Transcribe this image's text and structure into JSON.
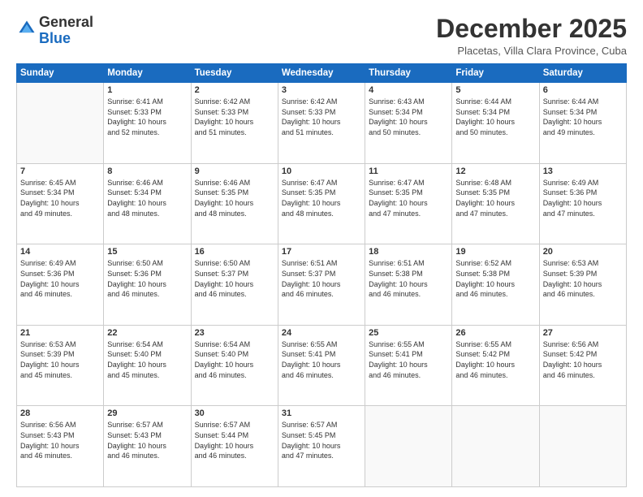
{
  "logo": {
    "general": "General",
    "blue": "Blue"
  },
  "header": {
    "month": "December 2025",
    "location": "Placetas, Villa Clara Province, Cuba"
  },
  "days": [
    "Sunday",
    "Monday",
    "Tuesday",
    "Wednesday",
    "Thursday",
    "Friday",
    "Saturday"
  ],
  "weeks": [
    [
      {
        "day": "",
        "content": ""
      },
      {
        "day": "1",
        "content": "Sunrise: 6:41 AM\nSunset: 5:33 PM\nDaylight: 10 hours\nand 52 minutes."
      },
      {
        "day": "2",
        "content": "Sunrise: 6:42 AM\nSunset: 5:33 PM\nDaylight: 10 hours\nand 51 minutes."
      },
      {
        "day": "3",
        "content": "Sunrise: 6:42 AM\nSunset: 5:33 PM\nDaylight: 10 hours\nand 51 minutes."
      },
      {
        "day": "4",
        "content": "Sunrise: 6:43 AM\nSunset: 5:34 PM\nDaylight: 10 hours\nand 50 minutes."
      },
      {
        "day": "5",
        "content": "Sunrise: 6:44 AM\nSunset: 5:34 PM\nDaylight: 10 hours\nand 50 minutes."
      },
      {
        "day": "6",
        "content": "Sunrise: 6:44 AM\nSunset: 5:34 PM\nDaylight: 10 hours\nand 49 minutes."
      }
    ],
    [
      {
        "day": "7",
        "content": "Sunrise: 6:45 AM\nSunset: 5:34 PM\nDaylight: 10 hours\nand 49 minutes."
      },
      {
        "day": "8",
        "content": "Sunrise: 6:46 AM\nSunset: 5:34 PM\nDaylight: 10 hours\nand 48 minutes."
      },
      {
        "day": "9",
        "content": "Sunrise: 6:46 AM\nSunset: 5:35 PM\nDaylight: 10 hours\nand 48 minutes."
      },
      {
        "day": "10",
        "content": "Sunrise: 6:47 AM\nSunset: 5:35 PM\nDaylight: 10 hours\nand 48 minutes."
      },
      {
        "day": "11",
        "content": "Sunrise: 6:47 AM\nSunset: 5:35 PM\nDaylight: 10 hours\nand 47 minutes."
      },
      {
        "day": "12",
        "content": "Sunrise: 6:48 AM\nSunset: 5:35 PM\nDaylight: 10 hours\nand 47 minutes."
      },
      {
        "day": "13",
        "content": "Sunrise: 6:49 AM\nSunset: 5:36 PM\nDaylight: 10 hours\nand 47 minutes."
      }
    ],
    [
      {
        "day": "14",
        "content": "Sunrise: 6:49 AM\nSunset: 5:36 PM\nDaylight: 10 hours\nand 46 minutes."
      },
      {
        "day": "15",
        "content": "Sunrise: 6:50 AM\nSunset: 5:36 PM\nDaylight: 10 hours\nand 46 minutes."
      },
      {
        "day": "16",
        "content": "Sunrise: 6:50 AM\nSunset: 5:37 PM\nDaylight: 10 hours\nand 46 minutes."
      },
      {
        "day": "17",
        "content": "Sunrise: 6:51 AM\nSunset: 5:37 PM\nDaylight: 10 hours\nand 46 minutes."
      },
      {
        "day": "18",
        "content": "Sunrise: 6:51 AM\nSunset: 5:38 PM\nDaylight: 10 hours\nand 46 minutes."
      },
      {
        "day": "19",
        "content": "Sunrise: 6:52 AM\nSunset: 5:38 PM\nDaylight: 10 hours\nand 46 minutes."
      },
      {
        "day": "20",
        "content": "Sunrise: 6:53 AM\nSunset: 5:39 PM\nDaylight: 10 hours\nand 46 minutes."
      }
    ],
    [
      {
        "day": "21",
        "content": "Sunrise: 6:53 AM\nSunset: 5:39 PM\nDaylight: 10 hours\nand 45 minutes."
      },
      {
        "day": "22",
        "content": "Sunrise: 6:54 AM\nSunset: 5:40 PM\nDaylight: 10 hours\nand 45 minutes."
      },
      {
        "day": "23",
        "content": "Sunrise: 6:54 AM\nSunset: 5:40 PM\nDaylight: 10 hours\nand 46 minutes."
      },
      {
        "day": "24",
        "content": "Sunrise: 6:55 AM\nSunset: 5:41 PM\nDaylight: 10 hours\nand 46 minutes."
      },
      {
        "day": "25",
        "content": "Sunrise: 6:55 AM\nSunset: 5:41 PM\nDaylight: 10 hours\nand 46 minutes."
      },
      {
        "day": "26",
        "content": "Sunrise: 6:55 AM\nSunset: 5:42 PM\nDaylight: 10 hours\nand 46 minutes."
      },
      {
        "day": "27",
        "content": "Sunrise: 6:56 AM\nSunset: 5:42 PM\nDaylight: 10 hours\nand 46 minutes."
      }
    ],
    [
      {
        "day": "28",
        "content": "Sunrise: 6:56 AM\nSunset: 5:43 PM\nDaylight: 10 hours\nand 46 minutes."
      },
      {
        "day": "29",
        "content": "Sunrise: 6:57 AM\nSunset: 5:43 PM\nDaylight: 10 hours\nand 46 minutes."
      },
      {
        "day": "30",
        "content": "Sunrise: 6:57 AM\nSunset: 5:44 PM\nDaylight: 10 hours\nand 46 minutes."
      },
      {
        "day": "31",
        "content": "Sunrise: 6:57 AM\nSunset: 5:45 PM\nDaylight: 10 hours\nand 47 minutes."
      },
      {
        "day": "",
        "content": ""
      },
      {
        "day": "",
        "content": ""
      },
      {
        "day": "",
        "content": ""
      }
    ]
  ]
}
